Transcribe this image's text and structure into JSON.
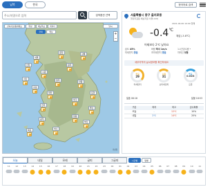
{
  "nav": {
    "tab_south": "남북",
    "tab_korea": "한국",
    "lang": "한국어로 검색",
    "menu": "메뉴"
  },
  "search": {
    "placeholder": "주소/지명으로 입력",
    "options": "검색옵션 선택"
  },
  "map": {
    "toolbar": [
      "관측지점/동네예보",
      "위성",
      "예보특보",
      "레이더"
    ],
    "filters": [
      "현재",
      "예보"
    ],
    "active_filter": "현재",
    "layer": "날씨",
    "copyright": "기상청"
  },
  "current": {
    "location": "서울특별시 중구 을지로동",
    "subtitle": "행정지표동 예보지점 서울(108)",
    "time": "2021.04.06 10:00 현재",
    "temp": "-0.4",
    "unit": "℃",
    "feels": "체감(-3.8℃)",
    "summary": "어제보다 2℃ 낮아요",
    "details": [
      {
        "k": "습도",
        "v": "45%"
      },
      {
        "k": "바람",
        "v": "북서 1m/s"
      },
      {
        "k": "1시간강수량",
        "v": "-"
      },
      {
        "k": "미세먼지",
        "v": "좋음"
      },
      {
        "k": "초미세먼지",
        "v": "좋음"
      },
      {
        "k": "자외선",
        "v": "보통"
      }
    ],
    "notice": "세부지역의 날씨정보를 확인하세요",
    "gauges": [
      {
        "label": "좋음",
        "name": "미세먼지",
        "value": "29",
        "color": "#f2b12a",
        "level": 0.35
      },
      {
        "label": "보통",
        "name": "초미세먼지",
        "value": "31",
        "color": "#f2b12a",
        "level": 0.5
      },
      {
        "label": "좋음",
        "name": "오존",
        "value": "0.023",
        "color": "#36a0de",
        "level": 0.3
      }
    ],
    "sun": {
      "sunrise": "일출 06:16",
      "sunset": "일몰 18:53"
    },
    "table_headers": [
      "구분",
      "최저",
      "최고",
      "강수확률"
    ],
    "table_rows": [
      [
        "오늘",
        "-",
        "12℃",
        "10%"
      ],
      [
        "내일",
        "2℃",
        "14℃",
        "20%"
      ]
    ]
  },
  "forecast": {
    "tabs": [
      "오늘",
      "내일",
      "모레",
      "글피",
      "그글피"
    ],
    "options": [
      "시간별",
      "일별"
    ],
    "hours": [
      "11",
      "12",
      "13",
      "14",
      "15",
      "16",
      "17",
      "18",
      "19",
      "20",
      "21",
      "22",
      "23",
      "00",
      "01",
      "02",
      "03",
      "04",
      "05",
      "06",
      "07",
      "08",
      "09",
      "10",
      "11"
    ],
    "icons": [
      "cloud",
      "cloud",
      "cloud",
      "sun",
      "sun",
      "sun",
      "cloud",
      "sun",
      "cloud",
      "sun",
      "sun",
      "sun",
      "cloud",
      "cloud",
      "sun",
      "sun",
      "cloud",
      "cloud",
      "sun",
      "cloud",
      "cloud",
      "cloud",
      "sun",
      "cloud",
      "cloud"
    ]
  },
  "regions": [
    "서울",
    "인천",
    "수원",
    "춘천",
    "강릉",
    "청주",
    "대전",
    "전주",
    "광주",
    "대구",
    "부산",
    "울산",
    "포항",
    "안동",
    "목포",
    "여수",
    "창원",
    "홍성",
    "원주",
    "서산"
  ]
}
